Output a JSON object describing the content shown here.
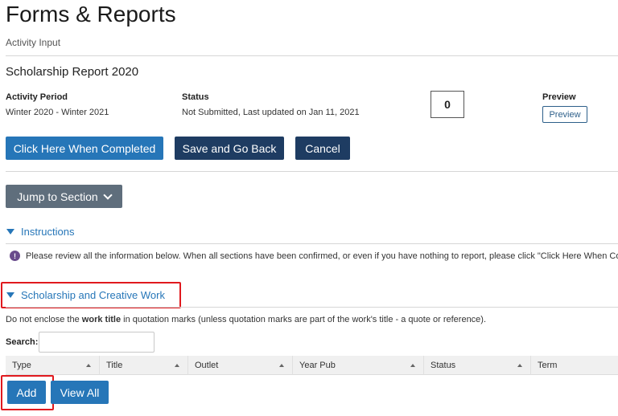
{
  "header": {
    "title": "Forms & Reports",
    "subtitle": "Activity Input"
  },
  "report": {
    "title": "Scholarship Report 2020",
    "activity_period_label": "Activity Period",
    "activity_period_value": "Winter 2020 - Winter 2021",
    "status_label": "Status",
    "status_value": "Not Submitted, Last updated on Jan 11, 2021",
    "count": "0",
    "preview_label": "Preview",
    "preview_button": "Preview"
  },
  "actions": {
    "complete": "Click Here When Completed",
    "save_back": "Save and Go Back",
    "cancel": "Cancel",
    "jump": "Jump to Section"
  },
  "sections": {
    "instructions": "Instructions",
    "notice": "Please review all the information below. When all sections have been confirmed, or even if you have nothing to report, please click \"Click Here When Complete",
    "scholarship": "Scholarship and Creative Work"
  },
  "scholarship": {
    "note_before": "Do not enclose the ",
    "note_bold": "work title",
    "note_after": " in quotation marks (unless quotation marks are part of the work's title - a quote or reference).",
    "search_label": "Search:",
    "search_value": "",
    "columns": [
      "Type",
      "Title",
      "Outlet",
      "Year Pub",
      "Status",
      "Term"
    ],
    "add": "Add",
    "view_all": "View All"
  },
  "colors": {
    "primary": "#2676b8",
    "dark": "#1e3c62",
    "gray": "#5f6e7c",
    "highlight": "#e0191e",
    "info": "#6a4c8c"
  },
  "icons": [
    "chevron-down-icon",
    "triangle-down-icon",
    "info-icon",
    "sort-caret-icon"
  ]
}
